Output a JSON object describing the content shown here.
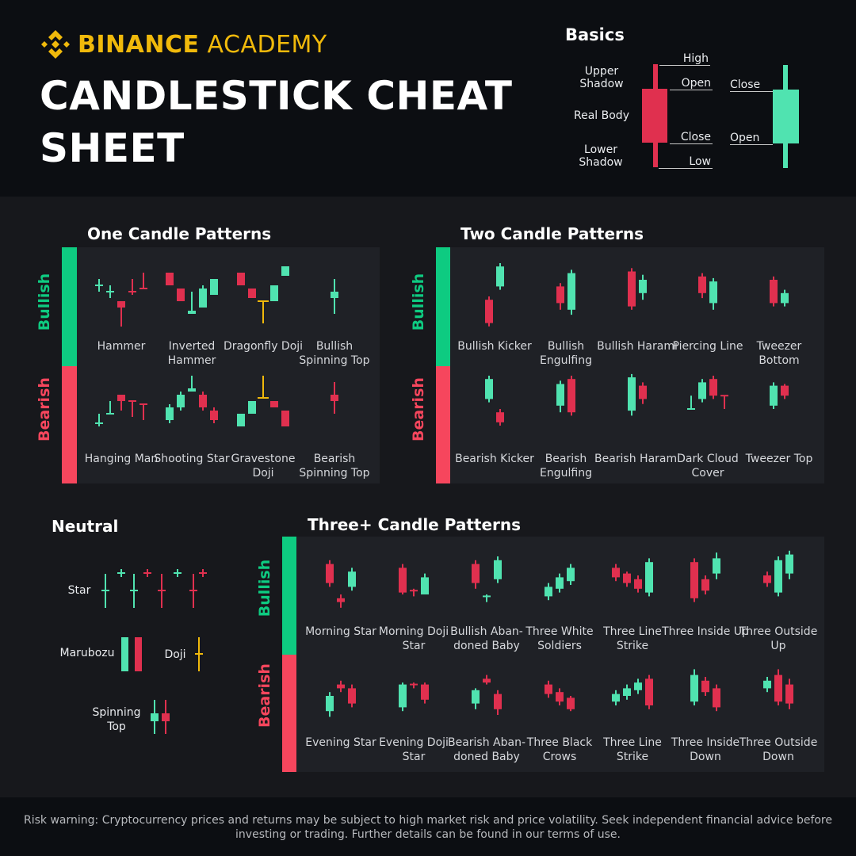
{
  "colors": {
    "bull": "#50e3b0",
    "bear": "#e0304f",
    "doji": "#f0b90b",
    "bull_side": "#0ecb81",
    "bear_side": "#f6465d",
    "brand": "#f0b90b"
  },
  "brand": {
    "bold": "BINANCE",
    "light": "ACADEMY",
    "logo_icon": "binance-diamond-logo"
  },
  "title": "CANDLESTICK CHEAT SHEET",
  "basics": {
    "title": "Basics",
    "left_labels": [
      "Upper Shadow",
      "Real Body",
      "Lower Shadow"
    ],
    "bear_candle_labels": [
      "High",
      "Open",
      "Close",
      "Low"
    ],
    "bull_candle_labels": [
      "Close",
      "Open"
    ]
  },
  "side_labels": {
    "bullish": "Bullish",
    "bearish": "Bearish"
  },
  "sections": {
    "one": {
      "title": "One Candle Patterns",
      "bullish": [
        {
          "name": "Hammer",
          "candles": [
            [
              58,
              58,
              62,
              54
            ],
            [
              54,
              54,
              58,
              50
            ],
            [
              48,
              44,
              48,
              32
            ],
            [
              54,
              54,
              62,
              52
            ],
            [
              56,
              56,
              66,
              56
            ]
          ]
        },
        {
          "name": "Inverted Hammer",
          "candles": [
            [
              66,
              58,
              66,
              58
            ],
            [
              56,
              48,
              56,
              48
            ],
            [
              40,
              42,
              54,
              40
            ],
            [
              44,
              56,
              58,
              44
            ],
            [
              52,
              62,
              62,
              52
            ]
          ]
        },
        {
          "name": "Dragonfly Doji",
          "candles": [
            [
              66,
              58,
              66,
              58
            ],
            [
              56,
              50,
              56,
              50
            ],
            [
              48,
              48,
              48,
              34
            ],
            [
              48,
              58,
              58,
              48
            ],
            [
              64,
              70,
              70,
              64
            ]
          ]
        },
        {
          "name": "Bullish Spinning Top",
          "candles": [
            [
              50,
              54,
              62,
              40
            ]
          ]
        }
      ],
      "bearish": [
        {
          "name": "Hanging Man",
          "candles": [
            [
              42,
              42,
              48,
              40
            ],
            [
              48,
              48,
              56,
              48
            ],
            [
              60,
              56,
              60,
              50
            ],
            [
              56,
              56,
              56,
              46
            ],
            [
              54,
              54,
              54,
              44
            ]
          ]
        },
        {
          "name": "Shooting Star",
          "candles": [
            [
              44,
              52,
              54,
              42
            ],
            [
              52,
              60,
              62,
              50
            ],
            [
              62,
              64,
              72,
              62
            ],
            [
              60,
              52,
              62,
              50
            ],
            [
              50,
              44,
              52,
              42
            ]
          ]
        },
        {
          "name": "Gravestone Doji",
          "candles": [
            [
              40,
              48,
              48,
              40
            ],
            [
              48,
              56,
              56,
              48
            ],
            [
              58,
              58,
              72,
              58
            ],
            [
              56,
              52,
              56,
              52
            ],
            [
              50,
              40,
              50,
              40
            ]
          ]
        },
        {
          "name": "Bearish Spinning Top",
          "candles": [
            [
              60,
              56,
              68,
              48
            ]
          ]
        }
      ]
    },
    "two": {
      "title": "Two Candle Patterns",
      "bullish": [
        {
          "name": "Bullish Kicker",
          "candles": [
            [
              54,
              40,
              56,
              38
            ],
            [
              62,
              74,
              76,
              60
            ]
          ]
        },
        {
          "name": "Bullish Engulfing",
          "candles": [
            [
              62,
              52,
              64,
              48
            ],
            [
              48,
              70,
              72,
              45
            ]
          ]
        },
        {
          "name": "Bullish Harami",
          "candles": [
            [
              71,
              50,
              73,
              48
            ],
            [
              58,
              66,
              69,
              54
            ]
          ]
        },
        {
          "name": "Piercing Line",
          "candles": [
            [
              68,
              58,
              70,
              55
            ],
            [
              52,
              65,
              67,
              48
            ]
          ]
        },
        {
          "name": "Tweezer Bottom",
          "candles": [
            [
              66,
              52,
              68,
              50
            ],
            [
              52,
              58,
              60,
              50
            ]
          ]
        }
      ],
      "bearish": [
        {
          "name": "Bearish Kicker",
          "candles": [
            [
              62,
              74,
              76,
              60
            ],
            [
              54,
              48,
              56,
              46
            ]
          ]
        },
        {
          "name": "Bearish Engulfing",
          "candles": [
            [
              58,
              71,
              73,
              54
            ],
            [
              74,
              54,
              76,
              52
            ]
          ]
        },
        {
          "name": "Bearish Harami",
          "candles": [
            [
              55,
              75,
              77,
              52
            ],
            [
              70,
              62,
              72,
              59
            ]
          ]
        },
        {
          "name": "Dark Cloud Cover",
          "candles": [
            [
              56,
              56,
              64,
              56
            ],
            [
              62,
              72,
              74,
              60
            ],
            [
              74,
              64,
              76,
              62
            ],
            [
              64,
              64,
              64,
              56
            ]
          ]
        },
        {
          "name": "Tweezer Top",
          "candles": [
            [
              58,
              70,
              72,
              56
            ],
            [
              70,
              64,
              71,
              62
            ]
          ]
        }
      ]
    },
    "neutral": {
      "title": "Neutral",
      "items": [
        {
          "name": "Star"
        },
        {
          "name": "Marubozu"
        },
        {
          "name": "Doji"
        },
        {
          "name": "Spinning Top"
        }
      ]
    },
    "three": {
      "title": "Three+ Candle Patterns",
      "bullish": [
        {
          "name": "Morning Star",
          "candles": [
            [
              72,
              62,
              74,
              60
            ],
            [
              54,
              52,
              56,
              49
            ],
            [
              60,
              68,
              70,
              58
            ]
          ]
        },
        {
          "name": "Morning Doji Star",
          "candles": [
            [
              70,
              57,
              72,
              56
            ],
            [
              58,
              58,
              59,
              55
            ],
            [
              56,
              65,
              67,
              56
            ]
          ]
        },
        {
          "name": "Bullish Abandoned Baby",
          "label": "Bullish Aban- doned Baby",
          "candles": [
            [
              72,
              62,
              74,
              59
            ],
            [
              55,
              55,
              56,
              52
            ],
            [
              64,
              74,
              76,
              62
            ]
          ]
        },
        {
          "name": "Three White Soldiers",
          "candles": [
            [
              55,
              60,
              62,
              53
            ],
            [
              59,
              65,
              67,
              57
            ],
            [
              63,
              70,
              72,
              61
            ]
          ]
        },
        {
          "name": "Three Line Strike",
          "candles": [
            [
              70,
              65,
              72,
              63
            ],
            [
              67,
              62,
              68,
              60
            ],
            [
              64,
              59,
              66,
              57
            ],
            [
              57,
              73,
              75,
              55
            ]
          ]
        },
        {
          "name": "Three Inside Up",
          "label": "Three Inside Up",
          "candles": [
            [
              73,
              54,
              75,
              52
            ],
            [
              64,
              58,
              66,
              56
            ],
            [
              67,
              75,
              78,
              64
            ]
          ]
        },
        {
          "name": "Three Outside Up",
          "candles": [
            [
              66,
              62,
              68,
              60
            ],
            [
              57,
              74,
              76,
              55
            ],
            [
              67,
              77,
              79,
              64
            ]
          ]
        }
      ],
      "bearish": [
        {
          "name": "Evening Star",
          "candles": [
            [
              53,
              61,
              63,
              50
            ],
            [
              67,
              65,
              69,
              63
            ],
            [
              65,
              57,
              67,
              55
            ]
          ]
        },
        {
          "name": "Evening Doji Star",
          "candles": [
            [
              55,
              67,
              68,
              53
            ],
            [
              67,
              67,
              68,
              65
            ],
            [
              67,
              59,
              68,
              57
            ]
          ]
        },
        {
          "name": "Bearish Abandoned Baby",
          "label": "Bearish Aban- doned Baby",
          "candles": [
            [
              57,
              64,
              65,
              54
            ],
            [
              70,
              68,
              72,
              67
            ],
            [
              62,
              54,
              64,
              51
            ]
          ]
        },
        {
          "name": "Three Black Crows",
          "candles": [
            [
              67,
              62,
              69,
              60
            ],
            [
              63,
              58,
              65,
              56
            ],
            [
              60,
              54,
              61,
              53
            ]
          ]
        },
        {
          "name": "Three Line Strike",
          "candles": [
            [
              58,
              62,
              64,
              56
            ],
            [
              61,
              65,
              67,
              59
            ],
            [
              64,
              68,
              70,
              62
            ],
            [
              70,
              56,
              72,
              54
            ]
          ]
        },
        {
          "name": "Three Inside Down",
          "candles": [
            [
              58,
              72,
              75,
              56
            ],
            [
              69,
              63,
              71,
              61
            ],
            [
              65,
              55,
              67,
              53
            ]
          ]
        },
        {
          "name": "Three Outside Down",
          "candles": [
            [
              65,
              69,
              71,
              63
            ],
            [
              72,
              58,
              75,
              56
            ],
            [
              67,
              57,
              70,
              54
            ]
          ]
        }
      ]
    }
  },
  "risk_warning": "Risk warning: Cryptocurrency prices and returns may be subject to high market risk and price volatility. Seek independent financial advice before investing or trading. Further details can be found in our terms of use."
}
